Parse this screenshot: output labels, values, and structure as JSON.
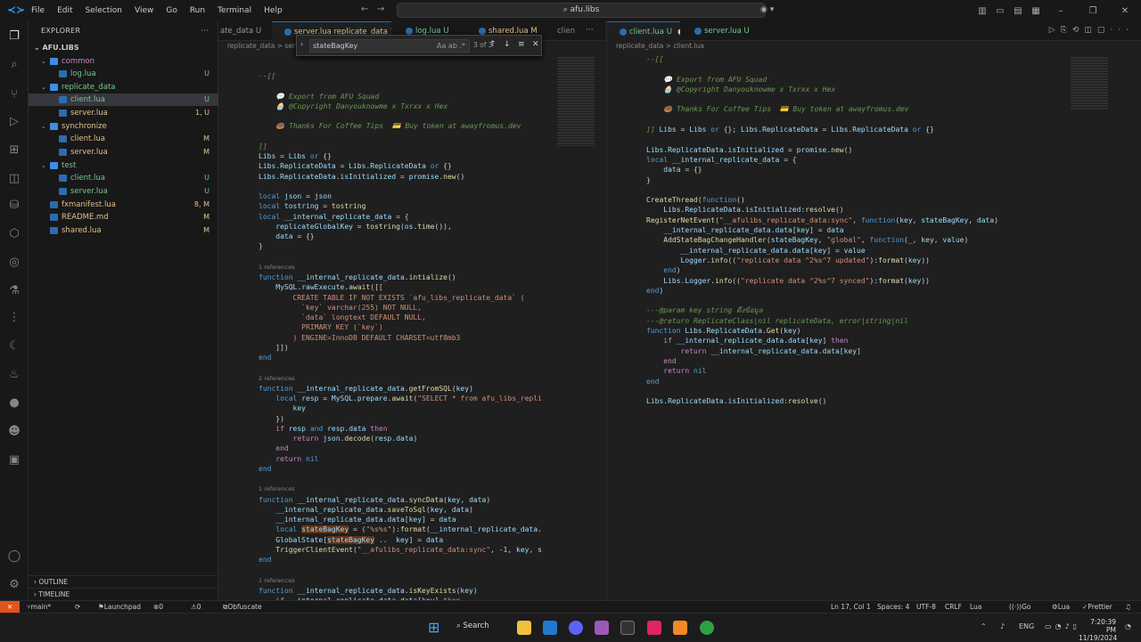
{
  "titlebar": {
    "menu": [
      "File",
      "Edit",
      "Selection",
      "View",
      "Go",
      "Run",
      "Terminal",
      "Help"
    ],
    "search": "afu.libs"
  },
  "explorer": {
    "title": "EXPLORER",
    "root": "AFU.LIBS",
    "items": [
      {
        "label": "common",
        "badge": "",
        "color": "#c586c0",
        "type": "folder"
      },
      {
        "label": "log.lua",
        "badge": "U",
        "color": "#73c991",
        "type": "file"
      },
      {
        "label": "replicate_data",
        "badge": "",
        "color": "#73c991",
        "type": "folder"
      },
      {
        "label": "client.lua",
        "badge": "U",
        "color": "#73c991",
        "type": "file"
      },
      {
        "label": "server.lua",
        "badge": "1, U",
        "color": "#e2c08d",
        "type": "file"
      },
      {
        "label": "synchronize",
        "badge": "",
        "color": "#e2c08d",
        "type": "folder"
      },
      {
        "label": "client.lua",
        "badge": "M",
        "color": "#e2c08d",
        "type": "file"
      },
      {
        "label": "server.lua",
        "badge": "M",
        "color": "#e2c08d",
        "type": "file"
      },
      {
        "label": "test",
        "badge": "",
        "color": "#73c991",
        "type": "folder"
      },
      {
        "label": "client.lua",
        "badge": "U",
        "color": "#73c991",
        "type": "file"
      },
      {
        "label": "server.lua",
        "badge": "U",
        "color": "#73c991",
        "type": "file"
      },
      {
        "label": "fxmanifest.lua",
        "badge": "8, M",
        "color": "#e2c08d",
        "type": "file"
      },
      {
        "label": "README.md",
        "badge": "M",
        "color": "#e2c08d",
        "type": "file"
      },
      {
        "label": "shared.lua",
        "badge": "M",
        "color": "#e2c08d",
        "type": "file"
      }
    ],
    "outline": "OUTLINE",
    "timeline": "TIMELINE"
  },
  "left_tabs": [
    "ate_data U",
    "server.lua replicate_data 1, U",
    "log.lua U",
    "shared.lua M",
    "clien"
  ],
  "left_crumbs": "replicate_data  >  server.lua  >  ...",
  "right_tabs": [
    "client.lua U",
    "server.lua U"
  ],
  "right_crumbs": "replicate_data  >  client.lua",
  "find": {
    "value": "stateBagKey",
    "count": "3 of 3"
  },
  "statusbar": {
    "branch": "main*",
    "launchpad": "Launchpad",
    "problems": "0  23",
    "warnings": "0",
    "obfuscate": "Obfuscate with Luraph",
    "position": "Ln 17, Col 1",
    "spaces": "Spaces: 4",
    "encoding": "UTF-8",
    "eol": "CRLF",
    "lang": "Lua",
    "golive": "Go Live",
    "lua2": "Lua",
    "prettier": "Prettier"
  },
  "taskbar": {
    "search": "Search",
    "lang": "ENG",
    "time": "7:20:39 PM",
    "date": "11/19/2024"
  }
}
